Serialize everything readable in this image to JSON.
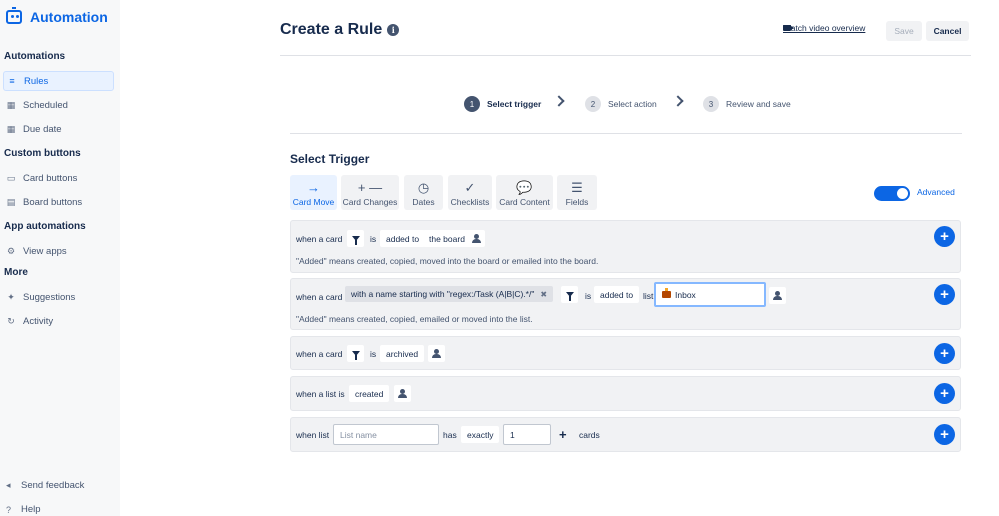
{
  "app": {
    "title": "Automation"
  },
  "sidebar": {
    "sections": [
      {
        "title": "Automations",
        "items": [
          {
            "label": "Rules",
            "icon": "sliders-icon",
            "active": true
          },
          {
            "label": "Scheduled",
            "icon": "calendar-icon"
          },
          {
            "label": "Due date",
            "icon": "calendar-clock-icon"
          }
        ]
      },
      {
        "title": "Custom buttons",
        "items": [
          {
            "label": "Card buttons",
            "icon": "card-icon"
          },
          {
            "label": "Board buttons",
            "icon": "board-icon"
          }
        ]
      },
      {
        "title": "App automations",
        "items": [
          {
            "label": "View apps",
            "icon": "gear-icon"
          }
        ]
      },
      {
        "title": "More",
        "items": [
          {
            "label": "Suggestions",
            "icon": "sparkle-icon"
          },
          {
            "label": "Activity",
            "icon": "refresh-icon"
          }
        ]
      }
    ],
    "footer": [
      {
        "label": "Send feedback",
        "icon": "megaphone-icon"
      },
      {
        "label": "Help",
        "icon": "question-icon"
      }
    ]
  },
  "header": {
    "title": "Create a Rule",
    "info_icon": "i",
    "watch_label": "Watch video overview",
    "save_label": "Save",
    "cancel_label": "Cancel"
  },
  "steps": [
    {
      "num": "1",
      "label": "Select trigger",
      "active": true
    },
    {
      "num": "2",
      "label": "Select action"
    },
    {
      "num": "3",
      "label": "Review and save"
    }
  ],
  "trigger": {
    "heading": "Select Trigger",
    "tabs": [
      {
        "label": "Card Move",
        "icon": "→",
        "active": true
      },
      {
        "label": "Card Changes",
        "icon": "+ —"
      },
      {
        "label": "Dates",
        "icon": "◷"
      },
      {
        "label": "Checklists",
        "icon": "✓"
      },
      {
        "label": "Card Content",
        "icon": "💬"
      },
      {
        "label": "Fields",
        "icon": "☰"
      }
    ],
    "advanced_label": "Advanced",
    "advanced_on": true
  },
  "rules": {
    "r1": {
      "when": "when a card",
      "is": "is",
      "action": "added to",
      "target": "the board",
      "note": "\"Added\" means created, copied, moved into the board or emailed into the board."
    },
    "r2": {
      "when": "when a card",
      "filter": "with a name starting with \"regex:/Task (A|B|C).*/\"",
      "filter_close": "✖",
      "is": "is",
      "action": "added to",
      "list_word": "list",
      "list_value": "Inbox",
      "note": "\"Added\" means created, copied, emailed or moved into the list."
    },
    "r3": {
      "when": "when a card",
      "is": "is",
      "action": "archived"
    },
    "r4": {
      "when": "when a list is",
      "action": "created"
    },
    "r5": {
      "when": "when list",
      "list_placeholder": "List name",
      "has": "has",
      "qualifier": "exactly",
      "count": "1",
      "unit": "cards"
    }
  },
  "colors": {
    "accent": "#0c66e4",
    "row_bg": "#f1f2f4"
  }
}
